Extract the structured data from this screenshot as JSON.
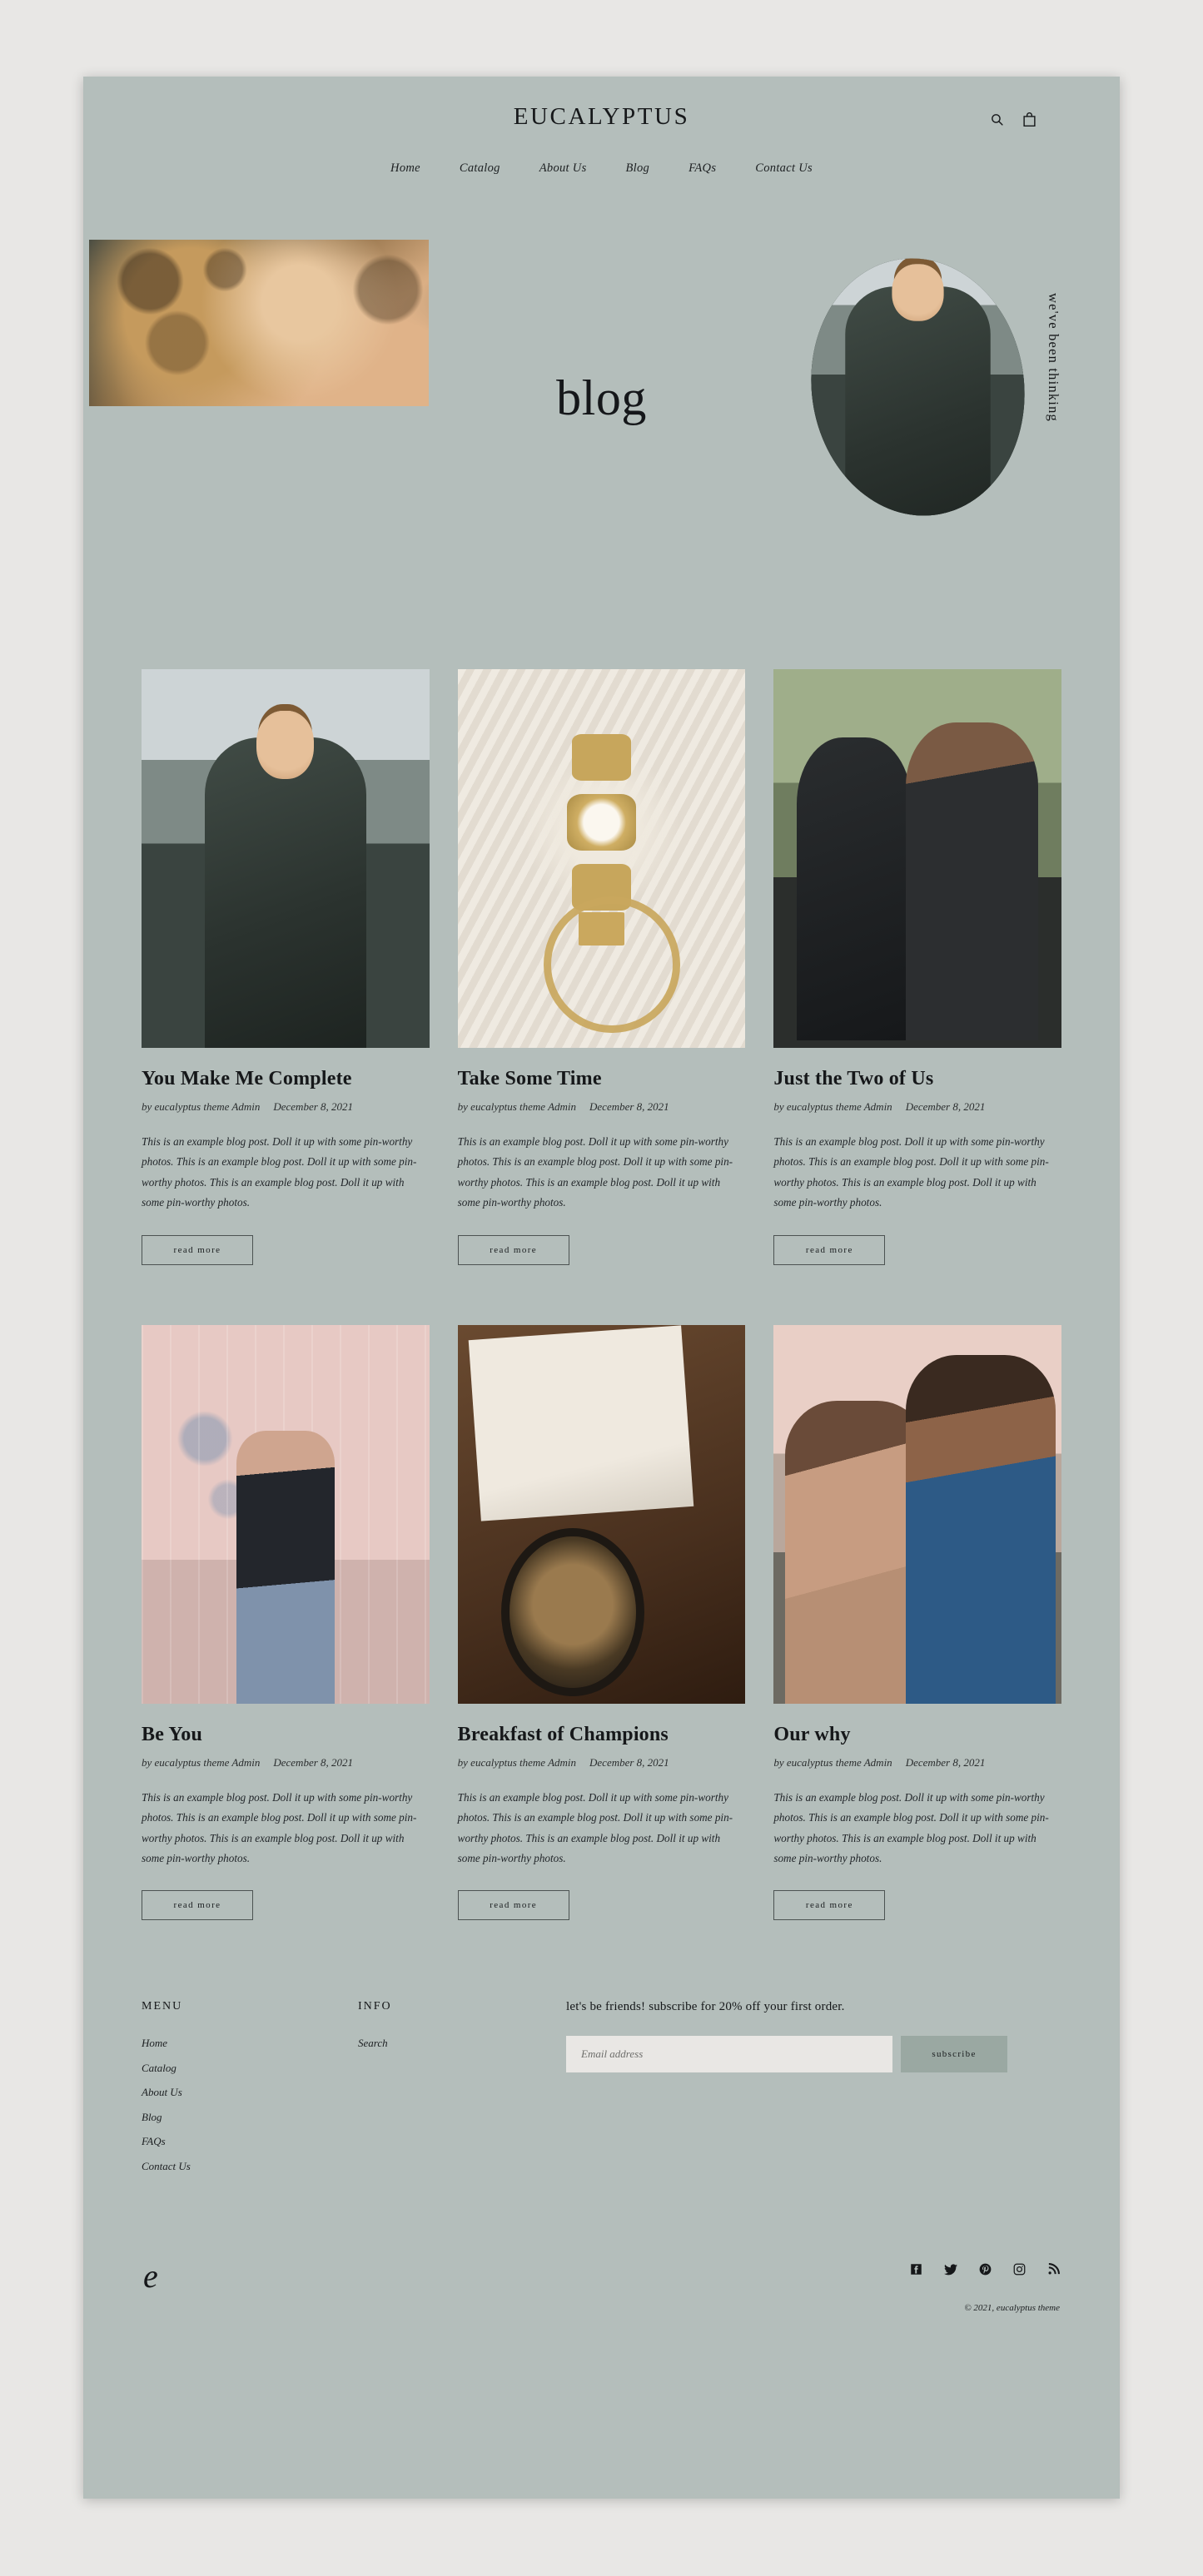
{
  "site": {
    "brand": "EUCALYPTUS",
    "monogram": "e"
  },
  "header": {
    "icons": [
      {
        "name": "search-icon",
        "label": "Search"
      },
      {
        "name": "shopping-bag-icon",
        "label": "Cart"
      }
    ],
    "nav": [
      {
        "label": "Home"
      },
      {
        "label": "Catalog"
      },
      {
        "label": "About Us"
      },
      {
        "label": "Blog"
      },
      {
        "label": "FAQs"
      },
      {
        "label": "Contact Us"
      }
    ]
  },
  "hero": {
    "title": "blog",
    "vertical_text": "we've been thinking",
    "left_image_alt": "woman with curly blonde hair resting on arm wearing a watch",
    "oval_image_alt": "man in grey suit adjusting his tie outdoors"
  },
  "posts": [
    {
      "title": "You Make Me Complete",
      "author": "by eucalyptus theme Admin",
      "date": "December 8, 2021",
      "excerpt": "This is an example blog post. Doll it up with some pin-worthy photos. This is an example blog post. Doll it up with some pin-worthy photos. This is an example blog post. Doll it up with some pin-worthy photos.",
      "cta": "read more",
      "image_alt": "man in grey suit adjusting his tie",
      "image_style": "ph-suit"
    },
    {
      "title": "Take Some Time",
      "author": "by eucalyptus theme Admin",
      "date": "December 8, 2021",
      "excerpt": "This is an example blog post. Doll it up with some pin-worthy photos. This is an example blog post. Doll it up with some pin-worthy photos. This is an example blog post. Doll it up with some pin-worthy photos.",
      "cta": "read more",
      "image_alt": "gold wristwatch and chain on cream knit sweater",
      "image_style": "ph-watch"
    },
    {
      "title": "Just the Two of Us",
      "author": "by eucalyptus theme Admin",
      "date": "December 8, 2021",
      "excerpt": "This is an example blog post. Doll it up with some pin-worthy photos. This is an example blog post. Doll it up with some pin-worthy photos. This is an example blog post. Doll it up with some pin-worthy photos.",
      "cta": "read more",
      "image_alt": "couple in leather jackets and sunglasses embracing",
      "image_style": "ph-couple"
    },
    {
      "title": "Be You",
      "author": "by eucalyptus theme Admin",
      "date": "December 8, 2021",
      "excerpt": "This is an example blog post. Doll it up with some pin-worthy photos. This is an example blog post. Doll it up with some pin-worthy photos. This is an example blog post. Doll it up with some pin-worthy photos.",
      "cta": "read more",
      "image_alt": "woman in black crop top and jeans against pink graffiti wall",
      "image_style": "ph-pinkwall"
    },
    {
      "title": "Breakfast of Champions",
      "author": "by eucalyptus theme Admin",
      "date": "December 8, 2021",
      "excerpt": "This is an example blog post. Doll it up with some pin-worthy photos. This is an example blog post. Doll it up with some pin-worthy photos. This is an example blog post. Doll it up with some pin-worthy photos.",
      "cta": "read more",
      "image_alt": "hands holding open book beside bowl of granola on wooden table",
      "image_style": "ph-breakfast"
    },
    {
      "title": "Our why",
      "author": "by eucalyptus theme Admin",
      "date": "December 8, 2021",
      "excerpt": "This is an example blog post. Doll it up with some pin-worthy photos. This is an example blog post. Doll it up with some pin-worthy photos. This is an example blog post. Doll it up with some pin-worthy photos.",
      "cta": "read more",
      "image_alt": "couple kissing on the forehead outdoors",
      "image_style": "ph-kiss"
    }
  ],
  "footer": {
    "menu": {
      "heading": "MENU",
      "links": [
        {
          "label": "Home"
        },
        {
          "label": "Catalog"
        },
        {
          "label": "About Us"
        },
        {
          "label": "Blog"
        },
        {
          "label": "FAQs"
        },
        {
          "label": "Contact Us"
        }
      ]
    },
    "info": {
      "heading": "INFO",
      "links": [
        {
          "label": "Search"
        }
      ]
    },
    "newsletter": {
      "heading": "let's be friends! subscribe for 20% off your first order.",
      "input_value": "",
      "placeholder": "Email address",
      "button_label": "subscribe"
    },
    "socials": [
      {
        "name": "facebook-icon",
        "label": "Facebook"
      },
      {
        "name": "twitter-icon",
        "label": "Twitter"
      },
      {
        "name": "pinterest-icon",
        "label": "Pinterest"
      },
      {
        "name": "instagram-icon",
        "label": "Instagram"
      },
      {
        "name": "rss-icon",
        "label": "RSS"
      }
    ],
    "copyright": "© 2021, eucalyptus theme"
  },
  "colors": {
    "page_background": "#b4bebb",
    "outer_background": "#e8e7e5",
    "text": "#16181a",
    "input_background": "#e9e7e4",
    "button_background": "#9aa8a2"
  }
}
